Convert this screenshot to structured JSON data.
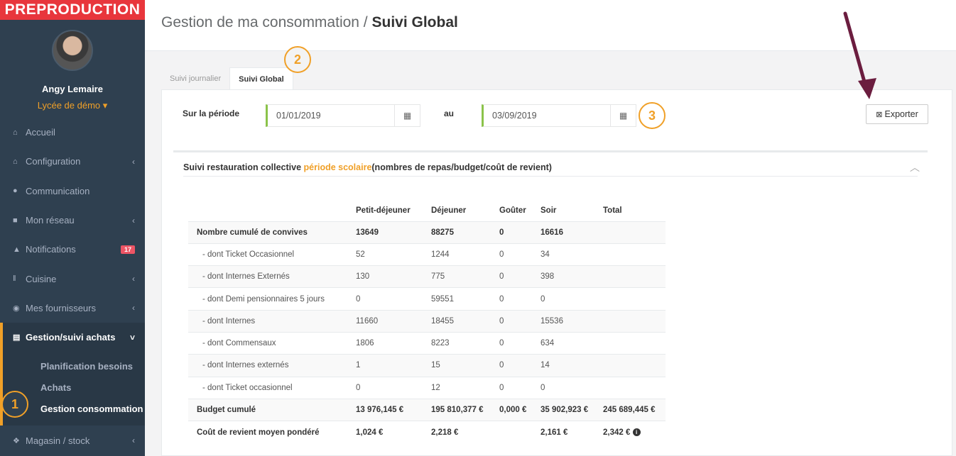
{
  "env_banner": "PREPRODUCTION",
  "profile": {
    "name": "Angy Lemaire",
    "school": "Lycée de démo ▾"
  },
  "menu": [
    {
      "icon": "home-icon",
      "glyph": "⌂",
      "label": "Accueil",
      "arrow": ""
    },
    {
      "icon": "bank-icon",
      "glyph": "⌂",
      "label": "Configuration",
      "arrow": "‹"
    },
    {
      "icon": "chat-icon",
      "glyph": "●",
      "label": "Communication",
      "arrow": ""
    },
    {
      "icon": "network-icon",
      "glyph": "■",
      "label": "Mon réseau",
      "arrow": "‹"
    },
    {
      "icon": "bell-icon",
      "glyph": "▲",
      "label": "Notifications",
      "badge": "17"
    },
    {
      "icon": "cutlery-icon",
      "glyph": "‖",
      "label": "Cuisine",
      "arrow": "‹"
    },
    {
      "icon": "handshake-icon",
      "glyph": "◉",
      "label": "Mes fournisseurs",
      "arrow": "‹"
    },
    {
      "icon": "cart-icon",
      "glyph": "▤",
      "label": "Gestion/suivi achats",
      "arrow": "˅"
    }
  ],
  "submenu": [
    "Planification besoins",
    "Achats",
    "Gestion consommation"
  ],
  "menu_last": {
    "icon": "cubes-icon",
    "glyph": "❖",
    "label": "Magasin / stock",
    "arrow": "‹"
  },
  "page_title_prefix": "Gestion de ma consommation / ",
  "page_title_bold": "Suivi Global",
  "tabs": [
    "Suivi journalier",
    "Suivi Global"
  ],
  "period": {
    "label": "Sur la période",
    "from": "01/01/2019",
    "to_label": "au",
    "to": "03/09/2019"
  },
  "export_label": "Exporter",
  "section": {
    "title_a": "Suivi restauration collective ",
    "title_hl": "période scolaire",
    "title_b": "(nombres de repas/budget/coût de revient)"
  },
  "table": {
    "headers": [
      "",
      "Petit-déjeuner",
      "Déjeuner",
      "Goûter",
      "Soir",
      "Total"
    ],
    "rows": [
      {
        "cells": [
          "Nombre cumulé de convives",
          "13649",
          "88275",
          "0",
          "16616",
          ""
        ],
        "bold": true
      },
      {
        "cells": [
          "- dont Ticket Occasionnel",
          "52",
          "1244",
          "0",
          "34",
          ""
        ]
      },
      {
        "cells": [
          "- dont Internes Externés",
          "130",
          "775",
          "0",
          "398",
          ""
        ]
      },
      {
        "cells": [
          "- dont Demi pensionnaires 5 jours",
          "0",
          "59551",
          "0",
          "0",
          ""
        ]
      },
      {
        "cells": [
          "- dont Internes",
          "11660",
          "18455",
          "0",
          "15536",
          ""
        ]
      },
      {
        "cells": [
          "- dont Commensaux",
          "1806",
          "8223",
          "0",
          "634",
          ""
        ]
      },
      {
        "cells": [
          "- dont Internes externés",
          "1",
          "15",
          "0",
          "14",
          ""
        ]
      },
      {
        "cells": [
          "- dont Ticket occasionnel",
          "0",
          "12",
          "0",
          "0",
          ""
        ]
      },
      {
        "cells": [
          "Budget cumulé",
          "13 976,145 €",
          "195 810,377 €",
          "0,000 €",
          "35 902,923 €",
          "245 689,445 €"
        ],
        "bold": true
      },
      {
        "cells": [
          "Coût de revient moyen pondéré",
          "1,024 €",
          "2,218 €",
          "",
          "2,161 €",
          "2,342 €"
        ],
        "bold": true
      }
    ]
  },
  "annotations": [
    "1",
    "2",
    "3"
  ],
  "colors": {
    "sidebar": "#2f4050",
    "accent": "#f0a028",
    "banner": "#e8363c",
    "arrow": "#6b1d3f",
    "date_border": "#8bc34a"
  }
}
